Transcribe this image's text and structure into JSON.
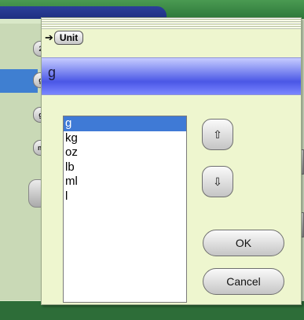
{
  "background": {
    "chips": [
      "2",
      "g",
      "g",
      "m"
    ]
  },
  "dialog": {
    "title": "Unit",
    "current_value": "g",
    "units": [
      "g",
      "kg",
      "oz",
      "lb",
      "ml",
      "l"
    ],
    "selected_index": 0,
    "up_icon": "⇧",
    "down_icon": "⇩",
    "ok_label": "OK",
    "cancel_label": "Cancel"
  }
}
